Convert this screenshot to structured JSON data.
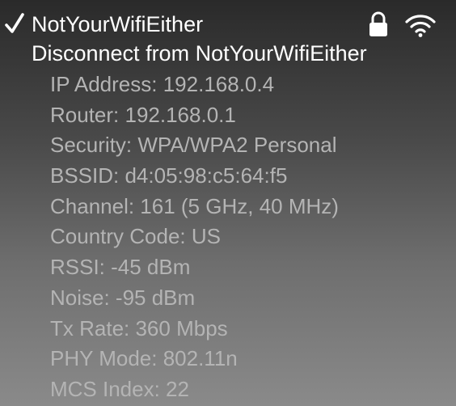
{
  "wifi_menu": {
    "current_network": {
      "name": "NotYourWifiEither",
      "connected": true,
      "secured": true,
      "icons": [
        "checkmark-icon",
        "lock-icon",
        "wifi-signal-icon"
      ]
    },
    "disconnect_label": "Disconnect from NotYourWifiEither",
    "details": [
      "IP Address: 192.168.0.4",
      "Router: 192.168.0.1",
      "Security: WPA/WPA2 Personal",
      "BSSID: d4:05:98:c5:64:f5",
      "Channel: 161 (5 GHz, 40 MHz)",
      "Country Code: US",
      "RSSI: -45 dBm",
      "Noise: -95 dBm",
      "Tx Rate: 360 Mbps",
      "PHY Mode: 802.11n",
      "MCS Index: 22"
    ]
  },
  "colors": {
    "primary_text": "#ffffff",
    "detail_text": "#b4b4b4",
    "background_top": "#2a2a2a",
    "background_bottom": "#8a8a8a"
  }
}
